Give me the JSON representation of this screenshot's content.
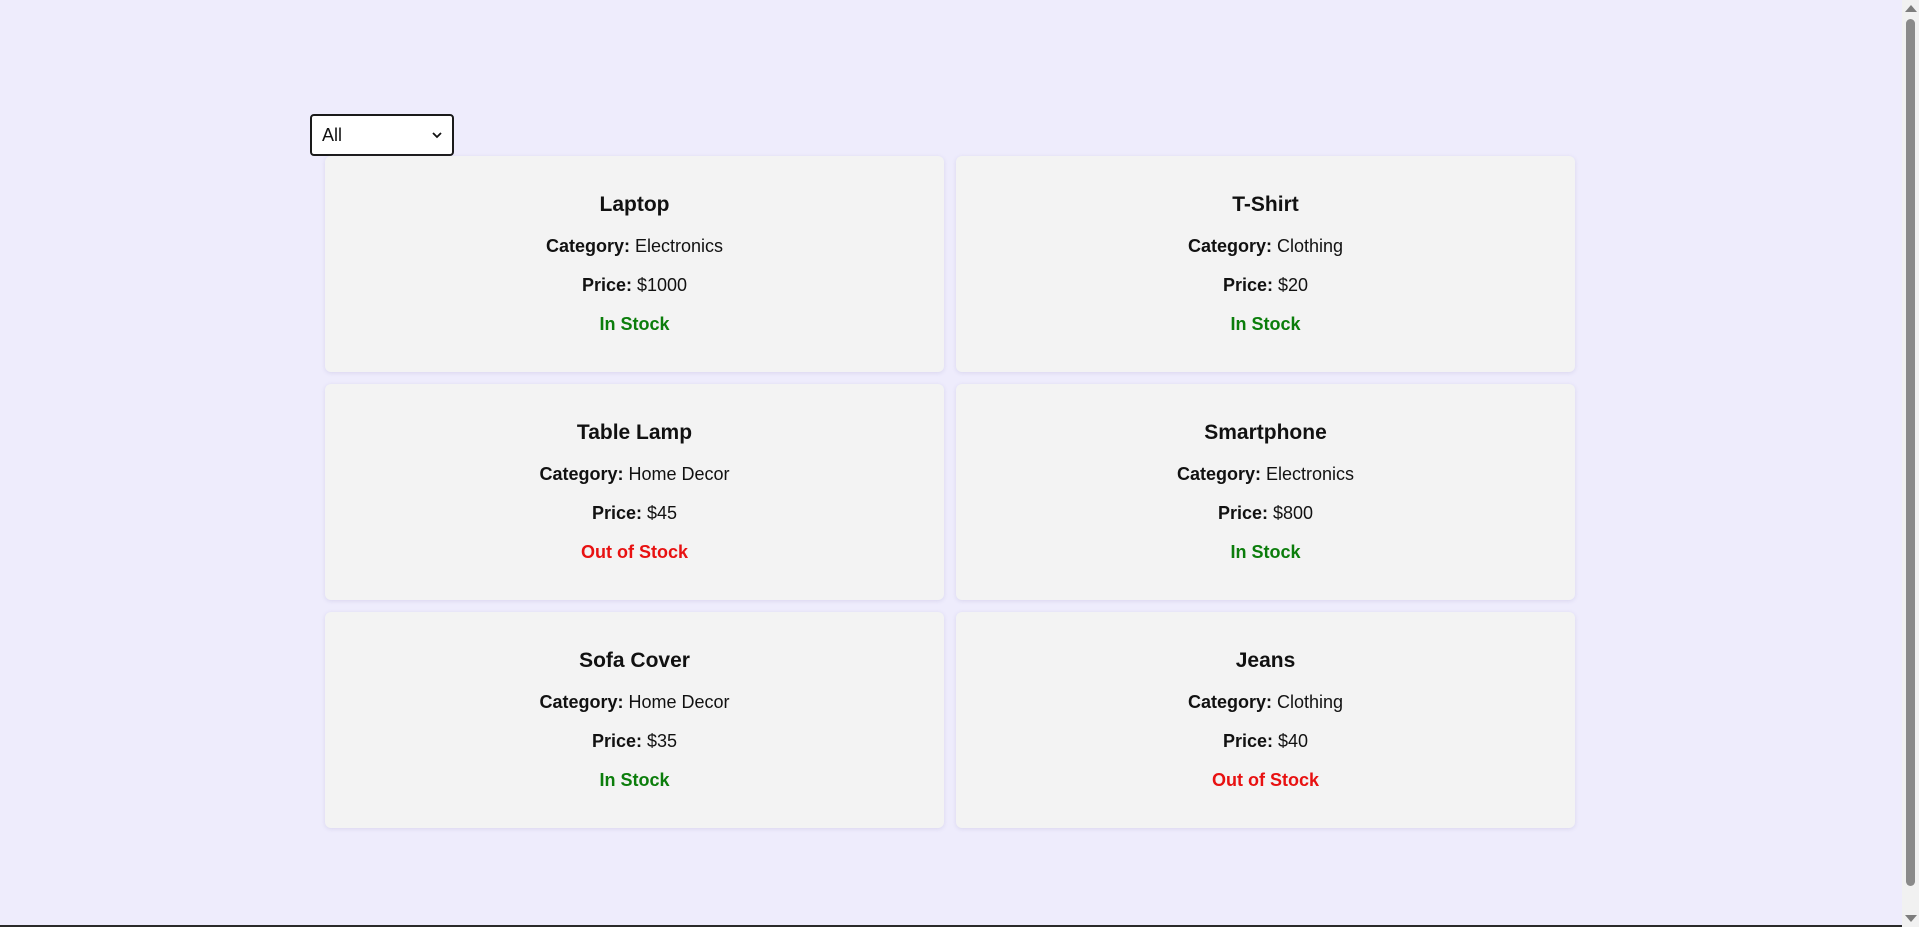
{
  "filter": {
    "selected": "All",
    "options": [
      "All"
    ]
  },
  "products": [
    {
      "name": "Laptop",
      "category_label": "Category:",
      "category": "Electronics",
      "price_label": "Price:",
      "price": "$1000",
      "stock": "In Stock",
      "in_stock": true
    },
    {
      "name": "T-Shirt",
      "category_label": "Category:",
      "category": "Clothing",
      "price_label": "Price:",
      "price": "$20",
      "stock": "In Stock",
      "in_stock": true
    },
    {
      "name": "Table Lamp",
      "category_label": "Category:",
      "category": "Home Decor",
      "price_label": "Price:",
      "price": "$45",
      "stock": "Out of Stock",
      "in_stock": false
    },
    {
      "name": "Smartphone",
      "category_label": "Category:",
      "category": "Electronics",
      "price_label": "Price:",
      "price": "$800",
      "stock": "In Stock",
      "in_stock": true
    },
    {
      "name": "Sofa Cover",
      "category_label": "Category:",
      "category": "Home Decor",
      "price_label": "Price:",
      "price": "$35",
      "stock": "In Stock",
      "in_stock": true
    },
    {
      "name": "Jeans",
      "category_label": "Category:",
      "category": "Clothing",
      "price_label": "Price:",
      "price": "$40",
      "stock": "Out of Stock",
      "in_stock": false
    }
  ],
  "colors": {
    "background": "#eeecfc",
    "card": "#f3f3f3",
    "in_stock": "#0b7d0b",
    "out_of_stock": "#e81111"
  },
  "icons": {
    "select_arrow": "chevron-down-icon"
  }
}
